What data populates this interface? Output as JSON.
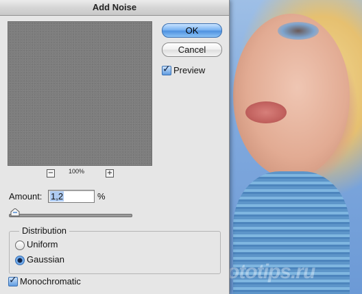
{
  "dialog": {
    "title": "Add Noise",
    "ok_label": "OK",
    "cancel_label": "Cancel",
    "preview": {
      "label": "Preview",
      "checked": true
    },
    "zoom": {
      "minus": "−",
      "plus": "+",
      "level": "100%"
    },
    "amount": {
      "label": "Amount:",
      "value": "1,2",
      "unit": "%",
      "slider_fraction": 0.012
    },
    "distribution": {
      "title": "Distribution",
      "options": [
        {
          "label": "Uniform",
          "selected": false
        },
        {
          "label": "Gaussian",
          "selected": true
        }
      ]
    },
    "monochromatic": {
      "label": "Monochromatic",
      "checked": true
    }
  },
  "background": {
    "watermark": "fototips.ru"
  },
  "colors": {
    "ok_button": "#5f9fe6",
    "dialog_bg": "#e6e6e6",
    "preview_gray": "#7d7d7d"
  }
}
